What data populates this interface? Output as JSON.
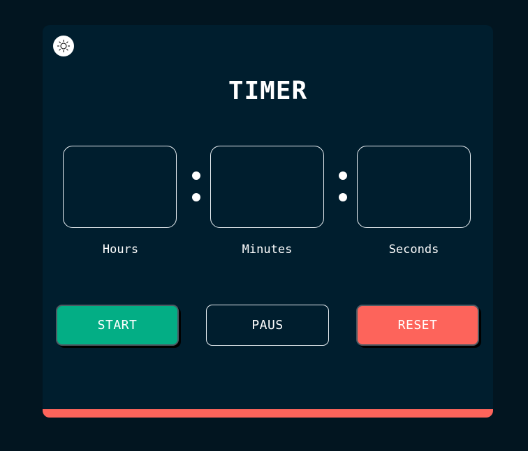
{
  "app": {
    "title": "TIMER"
  },
  "theme_toggle": {
    "icon": "sun-icon"
  },
  "time_fields": [
    {
      "label": "Hours",
      "value": "",
      "placeholder": ""
    },
    {
      "label": "Minutes",
      "value": "",
      "placeholder": ""
    },
    {
      "label": "Seconds",
      "value": "",
      "placeholder": ""
    }
  ],
  "buttons": {
    "start_label": "START",
    "pause_label": "PAUS",
    "reset_label": "RESET"
  },
  "colors": {
    "background": "#021520",
    "card": "#001e2e",
    "start": "#03ae85",
    "reset": "#fd645b",
    "accent_bar": "#fd645b",
    "text": "#ffffff"
  }
}
